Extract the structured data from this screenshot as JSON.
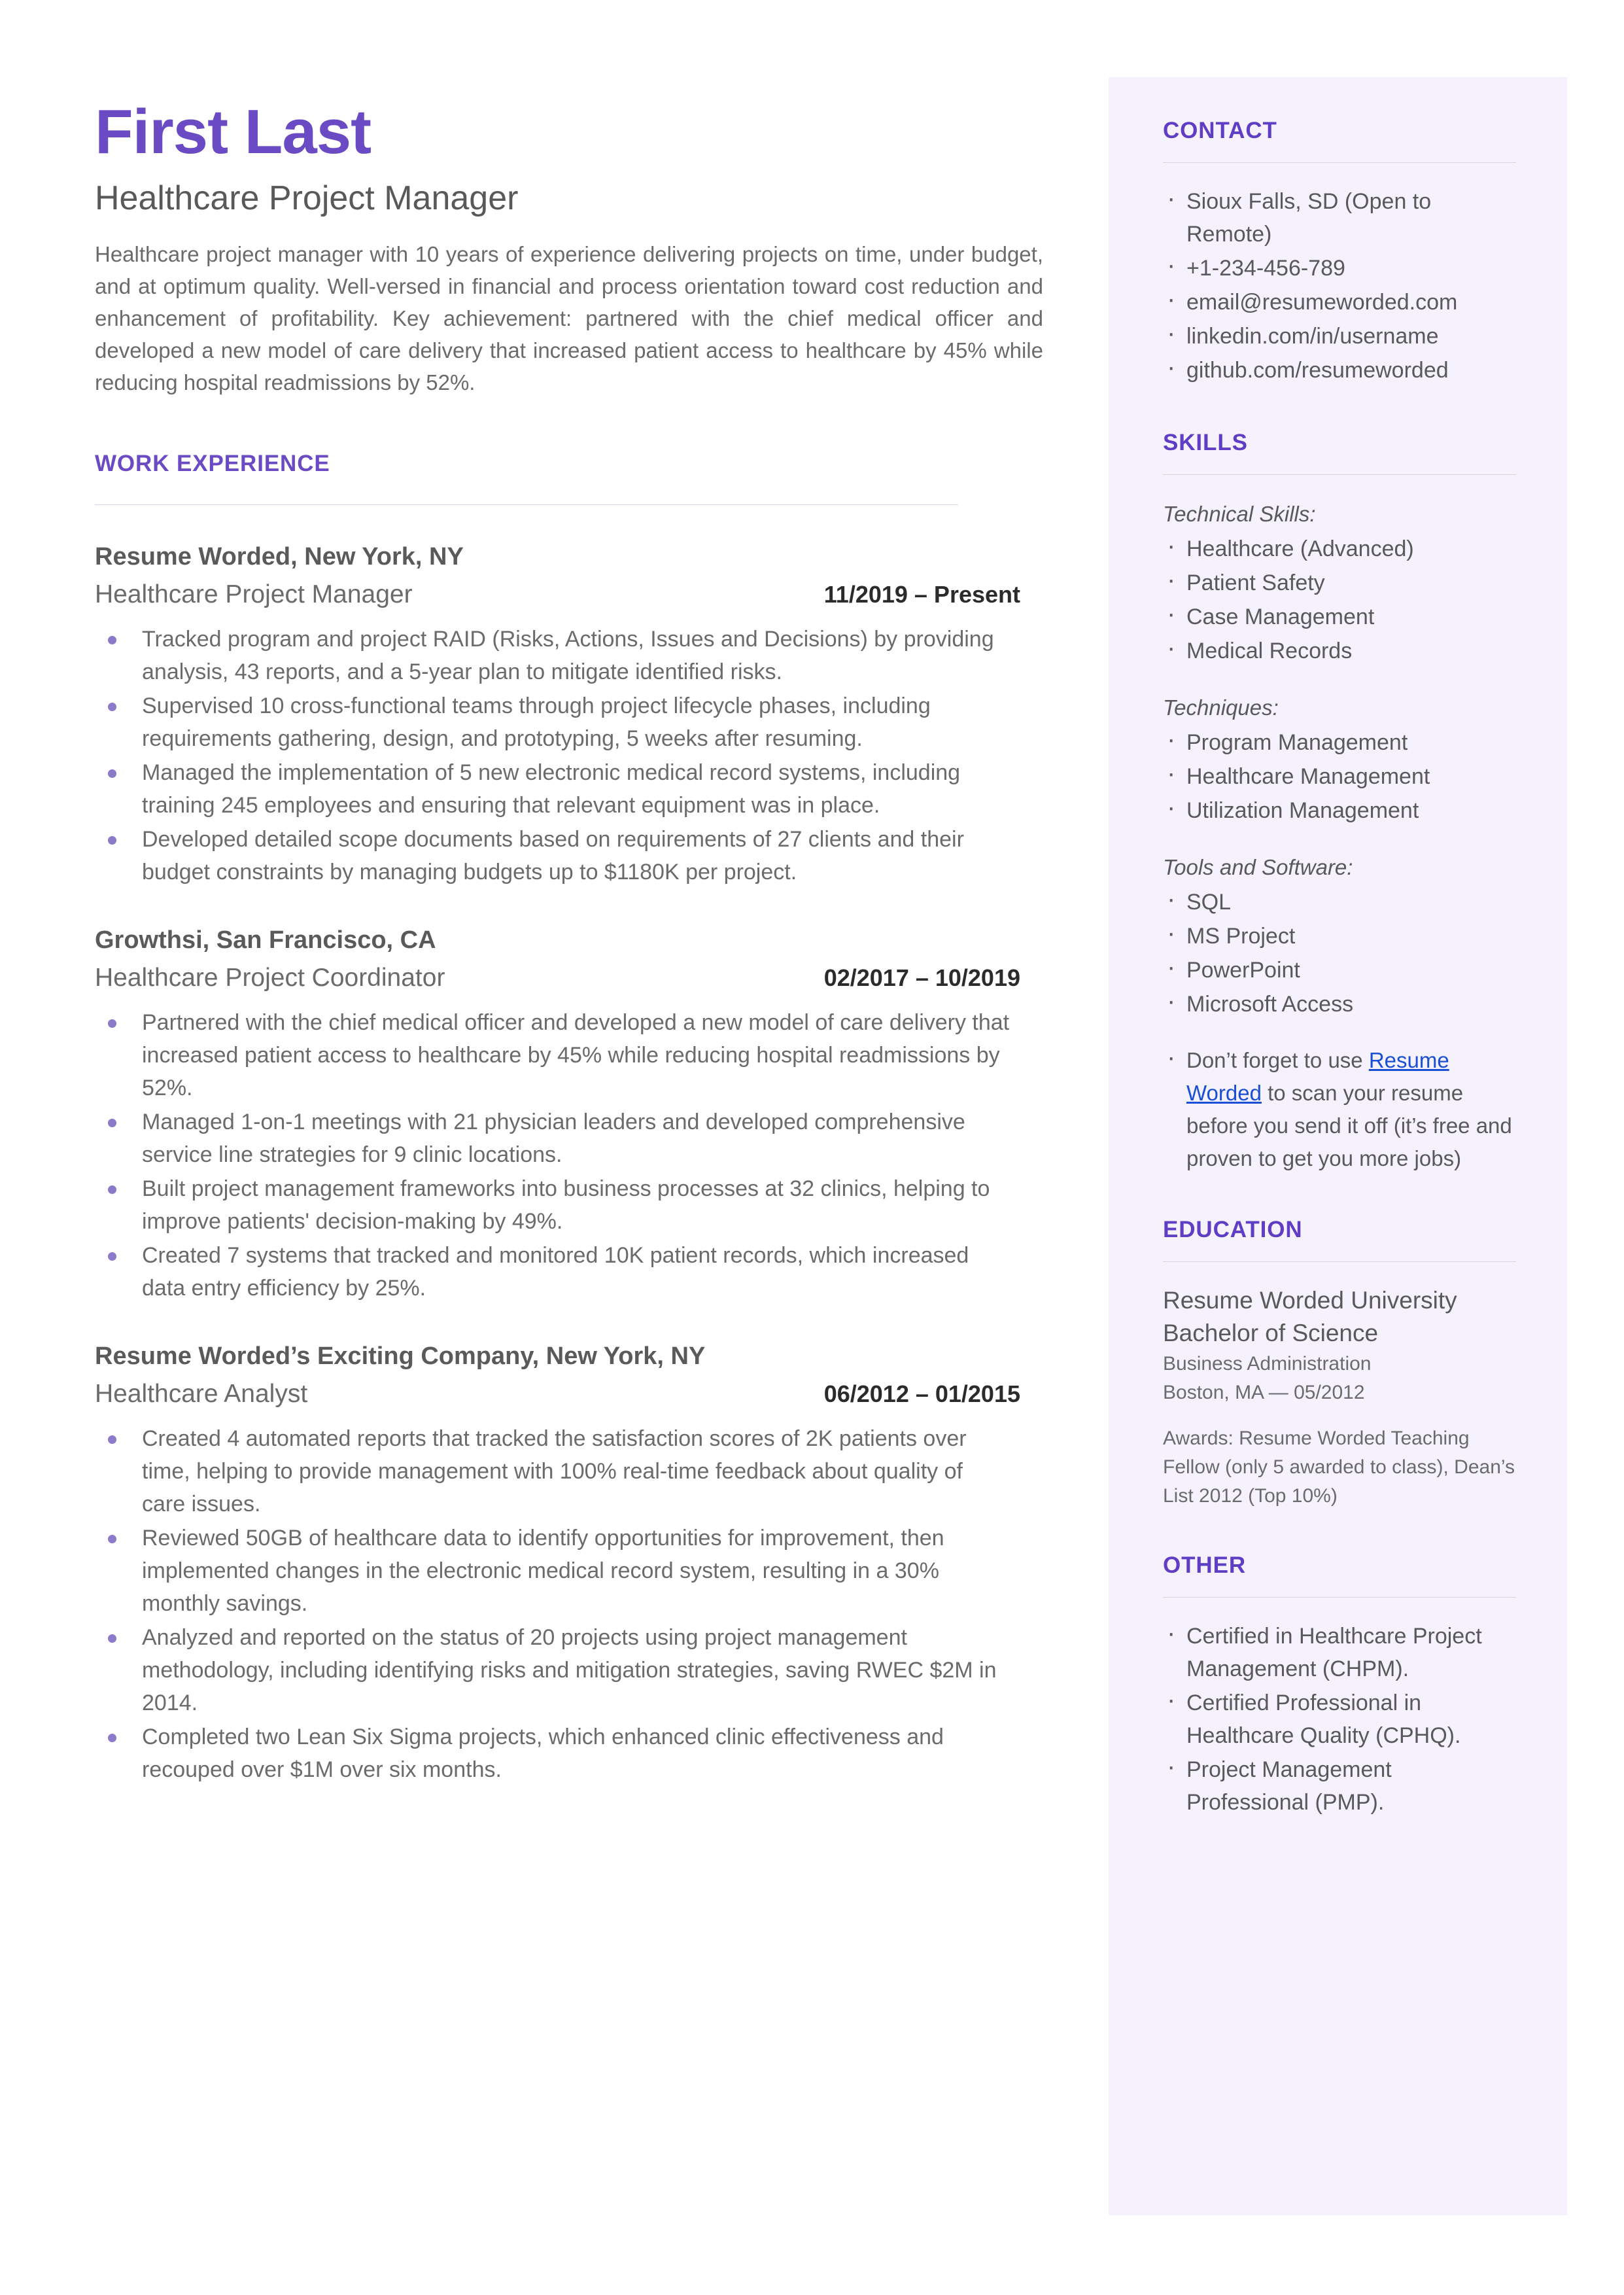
{
  "colors": {
    "accent_purple": "#6b4bc4",
    "sidebar_bg": "#f5f2fd",
    "body_text": "#6b6b6d",
    "link_blue": "#1a4fd6",
    "bullet_dot": "#8b79c9"
  },
  "header": {
    "name": "First Last",
    "headline": "Healthcare Project Manager",
    "summary": "Healthcare project manager with 10 years of experience delivering projects on time, under budget, and at optimum quality. Well-versed in financial and process orientation toward cost reduction and enhancement of profitability. Key achievement: partnered with the chief medical officer and developed a new model of care delivery that increased patient access to healthcare by 45% while reducing hospital readmissions by 52%."
  },
  "work_experience": {
    "section_title": "WORK EXPERIENCE",
    "jobs": [
      {
        "company": "Resume Worded, New York, NY",
        "title": "Healthcare Project Manager",
        "dates": "11/2019 – Present",
        "bullets": [
          "Tracked program and project RAID (Risks, Actions, Issues and Decisions) by providing analysis, 43 reports, and a 5-year plan to mitigate identified risks.",
          "Supervised 10 cross-functional teams through project lifecycle phases, including requirements gathering, design, and prototyping, 5 weeks after resuming.",
          "Managed the implementation of 5 new electronic medical record systems, including training 245 employees and ensuring that relevant equipment was in place.",
          "Developed detailed scope documents based on requirements of 27 clients and their budget constraints by managing budgets up to $1180K per project."
        ]
      },
      {
        "company": "Growthsi, San Francisco, CA",
        "title": "Healthcare Project Coordinator",
        "dates": "02/2017 – 10/2019",
        "bullets": [
          "Partnered with the chief medical officer and developed a new model of care delivery that increased patient access to healthcare by 45% while reducing hospital readmissions by 52%.",
          "Managed 1-on-1 meetings with 21 physician leaders and developed comprehensive service line strategies for 9 clinic locations.",
          "Built project management frameworks into business processes at 32 clinics, helping to improve patients' decision-making by 49%.",
          "Created 7 systems that tracked and monitored 10K patient records, which increased data entry efficiency by 25%."
        ]
      },
      {
        "company": "Resume Worded’s Exciting Company, New York, NY",
        "title": "Healthcare Analyst",
        "dates": "06/2012 – 01/2015",
        "bullets": [
          "Created 4 automated reports that tracked the satisfaction scores of 2K patients over time, helping to provide management with 100% real-time feedback about quality of care issues.",
          "Reviewed 50GB of healthcare data to identify opportunities for improvement, then implemented changes in the electronic medical record system, resulting in a 30% monthly savings.",
          "Analyzed and reported on the status of 20 projects using project management methodology, including identifying risks and mitigation strategies, saving RWEC $2M in 2014.",
          "Completed two Lean Six Sigma projects, which enhanced clinic effectiveness and recouped over $1M over six months."
        ]
      }
    ]
  },
  "sidebar": {
    "contact": {
      "title": "CONTACT",
      "items": [
        "Sioux Falls, SD (Open to Remote)",
        "+1-234-456-789",
        "email@resumeworded.com",
        "linkedin.com/in/username",
        "github.com/resumeworded"
      ]
    },
    "skills": {
      "title": "SKILLS",
      "groups": [
        {
          "label": "Technical Skills:",
          "items": [
            "Healthcare (Advanced)",
            "Patient Safety",
            "Case Management",
            "Medical Records"
          ]
        },
        {
          "label": "Techniques:",
          "items": [
            "Program Management",
            "Healthcare Management",
            "Utilization Management"
          ]
        },
        {
          "label": "Tools and Software:",
          "items": [
            "SQL",
            "MS Project",
            "PowerPoint",
            "Microsoft Access"
          ]
        }
      ],
      "note": {
        "before_link": "Don’t forget to use ",
        "link_text": "Resume Worded",
        "after_link": " to scan your resume before you send it off (it’s free and proven to get you more jobs)"
      }
    },
    "education": {
      "title": "EDUCATION",
      "school": "Resume Worded University",
      "degree": "Bachelor of Science",
      "field": "Business Administration",
      "location_date": "Boston, MA — 05/2012",
      "awards": "Awards: Resume Worded Teaching Fellow (only 5 awarded to class), Dean’s List 2012 (Top 10%)"
    },
    "other": {
      "title": "OTHER",
      "items": [
        "Certified in Healthcare Project Management (CHPM).",
        "Certified Professional in Healthcare Quality (CPHQ).",
        "Project Management Professional (PMP)."
      ]
    }
  }
}
